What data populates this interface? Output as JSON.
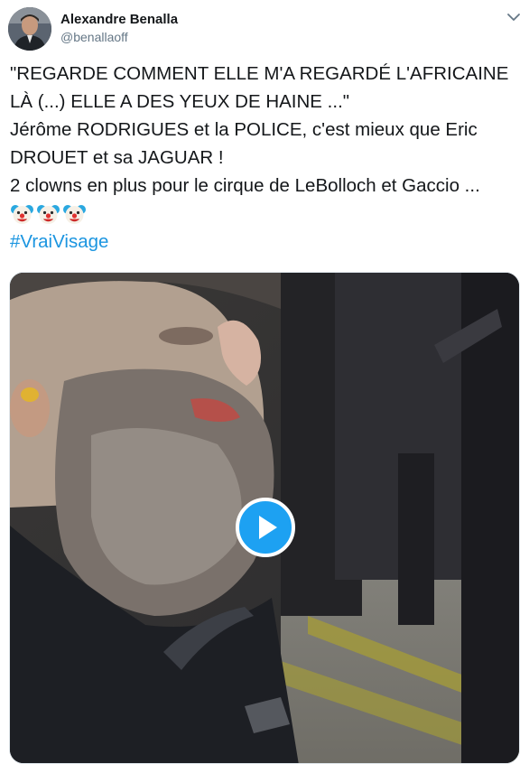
{
  "author": {
    "name": "Alexandre Benalla",
    "handle": "@benallaoff"
  },
  "tweet": {
    "line1": "\"REGARDE COMMENT ELLE M'A REGARDÉ L'AFRICAINE LÀ (...) ELLE A DES YEUX DE HAINE ...\"",
    "line2": "Jérôme RODRIGUES et la POLICE, c'est mieux que Eric DROUET et sa JAGUAR !",
    "line3": "2 clowns en plus pour le cirque de LeBolloch et Gaccio ...",
    "emoji_count": 3,
    "emoji_icon": "clown-face-icon",
    "hashtag": "#VraiVisage"
  },
  "media": {
    "type": "video",
    "control_icon": "play-icon"
  },
  "colors": {
    "accent": "#1da1f2",
    "link": "#1b95e0",
    "secondary_text": "#657786"
  }
}
